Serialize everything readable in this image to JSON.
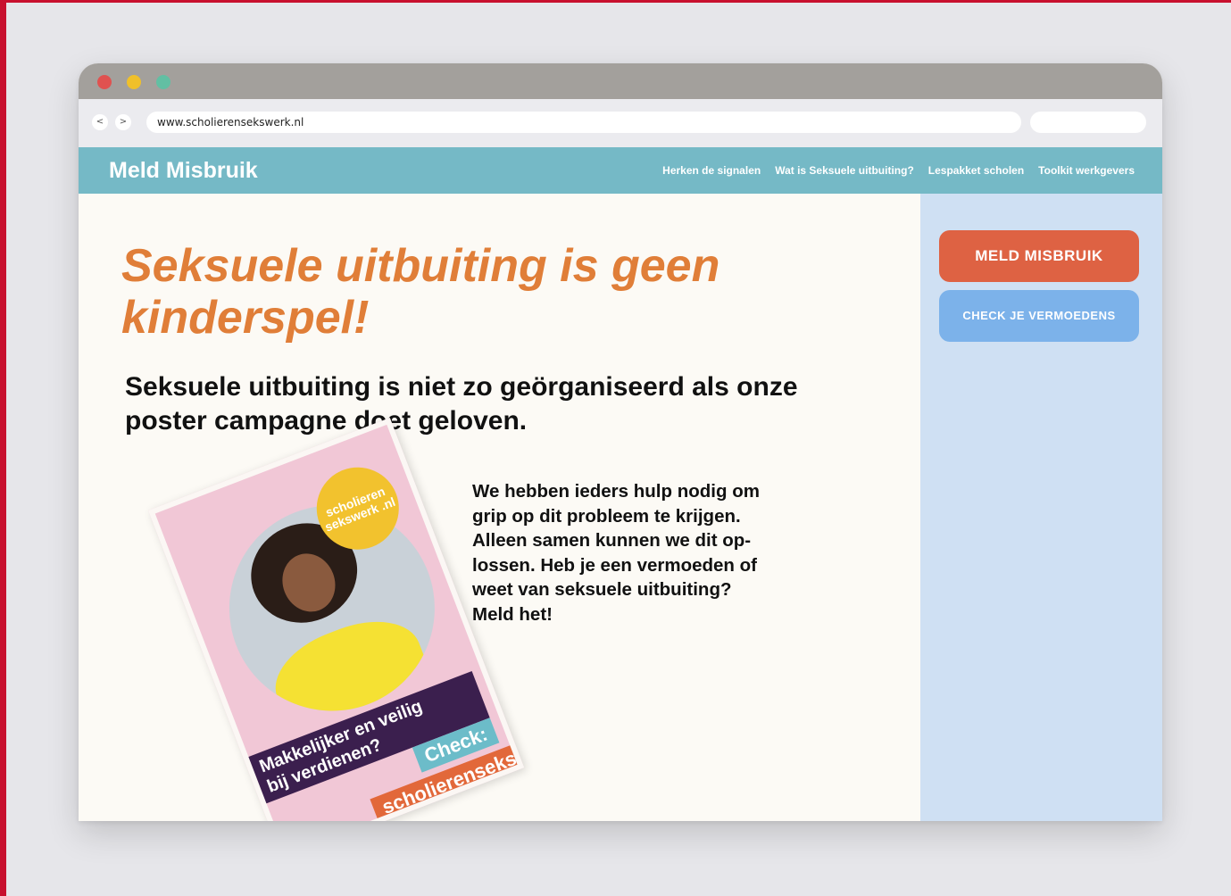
{
  "browser": {
    "url": "www.scholierensekswerk.nl",
    "nav_back": "<",
    "nav_forward": ">"
  },
  "site": {
    "logo": "Meld Misbruik",
    "nav": [
      {
        "label": "Herken de signalen"
      },
      {
        "label": "Wat is Seksuele uitbuiting?"
      },
      {
        "label": "Lespakket scholen"
      },
      {
        "label": "Toolkit werkgevers"
      }
    ]
  },
  "main": {
    "headline": "Seksuele uitbuiting is geen kinderspel!",
    "subheadline": "Seksuele uitbuiting is niet zo geörganiseerd als onze poster campagne doet geloven.",
    "body": "We hebben ieders hulp nodig om\ngrip op dit probleem te krijgen.\nAlleen samen kunnen we dit op-\nlossen. Heb je een vermoeden of\nweet van seksuele uitbuiting?\nMeld het!"
  },
  "poster": {
    "badge": "scholieren sekswerk .nl",
    "tagline": "Makkelijker en veilig\nbij verdienen?",
    "check": "Check:",
    "url": "scholierensekswerk.nl"
  },
  "sidebar": {
    "report_button": "MELD MISBRUIK",
    "check_button": "CHECK JE VERMOEDENS"
  },
  "colors": {
    "nav_bar": "#75b9c6",
    "headline": "#e07e38",
    "report_button": "#de6243",
    "check_button": "#7cb2ea",
    "sidebar": "#cfe0f3",
    "accent_red": "#c8102e"
  }
}
